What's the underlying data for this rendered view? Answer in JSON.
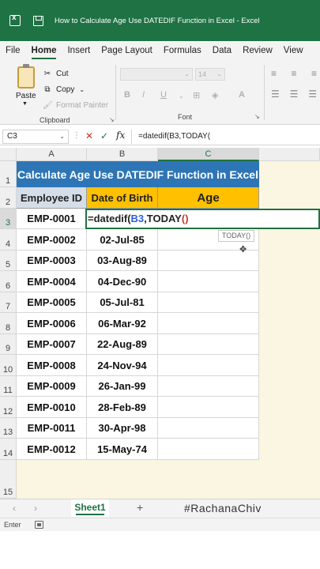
{
  "window": {
    "title": "How to Calculate Age Use DATEDIF Function in Excel  -  Excel"
  },
  "menu": {
    "tabs": [
      "File",
      "Home",
      "Insert",
      "Page Layout",
      "Formulas",
      "Data",
      "Review",
      "View"
    ],
    "active": "Home"
  },
  "ribbon": {
    "clipboard": {
      "paste": "Paste",
      "cut": "Cut",
      "copy": "Copy",
      "format_painter": "Format Painter",
      "group_label": "Clipboard"
    },
    "font": {
      "font_name": "",
      "font_size": "14",
      "bold": "B",
      "italic": "I",
      "underline": "U",
      "group_label": "Font"
    }
  },
  "formula_bar": {
    "name_box": "C3",
    "fx": "fx",
    "content": "=datedif(B3,TODAY("
  },
  "columns": [
    "A",
    "B",
    "C"
  ],
  "rows": [
    "1",
    "2",
    "3",
    "4",
    "5",
    "6",
    "7",
    "8",
    "9",
    "10",
    "11",
    "12",
    "13",
    "14",
    "15"
  ],
  "sheet": {
    "banner": "Calculate Age Use DATEDIF Function in Excel",
    "headers": {
      "id": "Employee ID",
      "dob": "Date of Birth",
      "age": "Age"
    },
    "employees": [
      {
        "id": "EMP-0001",
        "dob": ""
      },
      {
        "id": "EMP-0002",
        "dob": "02-Jul-85"
      },
      {
        "id": "EMP-0003",
        "dob": "03-Aug-89"
      },
      {
        "id": "EMP-0004",
        "dob": "04-Dec-90"
      },
      {
        "id": "EMP-0005",
        "dob": "05-Jul-81"
      },
      {
        "id": "EMP-0006",
        "dob": "06-Mar-92"
      },
      {
        "id": "EMP-0007",
        "dob": "22-Aug-89"
      },
      {
        "id": "EMP-0008",
        "dob": "24-Nov-94"
      },
      {
        "id": "EMP-0009",
        "dob": "26-Jan-99"
      },
      {
        "id": "EMP-0010",
        "dob": "28-Feb-89"
      },
      {
        "id": "EMP-0011",
        "dob": "30-Apr-98"
      },
      {
        "id": "EMP-0012",
        "dob": "15-May-74"
      }
    ],
    "editing": {
      "prefix": "=datedif(",
      "ref": "B3",
      "middle": ",TODAY",
      "parens": "()"
    },
    "tooltip": "TODAY()"
  },
  "sheet_tabs": {
    "active": "Sheet1",
    "watermark": "#RachanaChiv"
  },
  "status": {
    "mode": "Enter"
  },
  "colors": {
    "excel_green": "#1f7244",
    "banner_blue": "#2e75b6",
    "header_gold": "#ffc000",
    "header_gray_blue": "#d5dde8",
    "ref_blue": "#2f5dd8",
    "paren_red": "#c0392b"
  }
}
